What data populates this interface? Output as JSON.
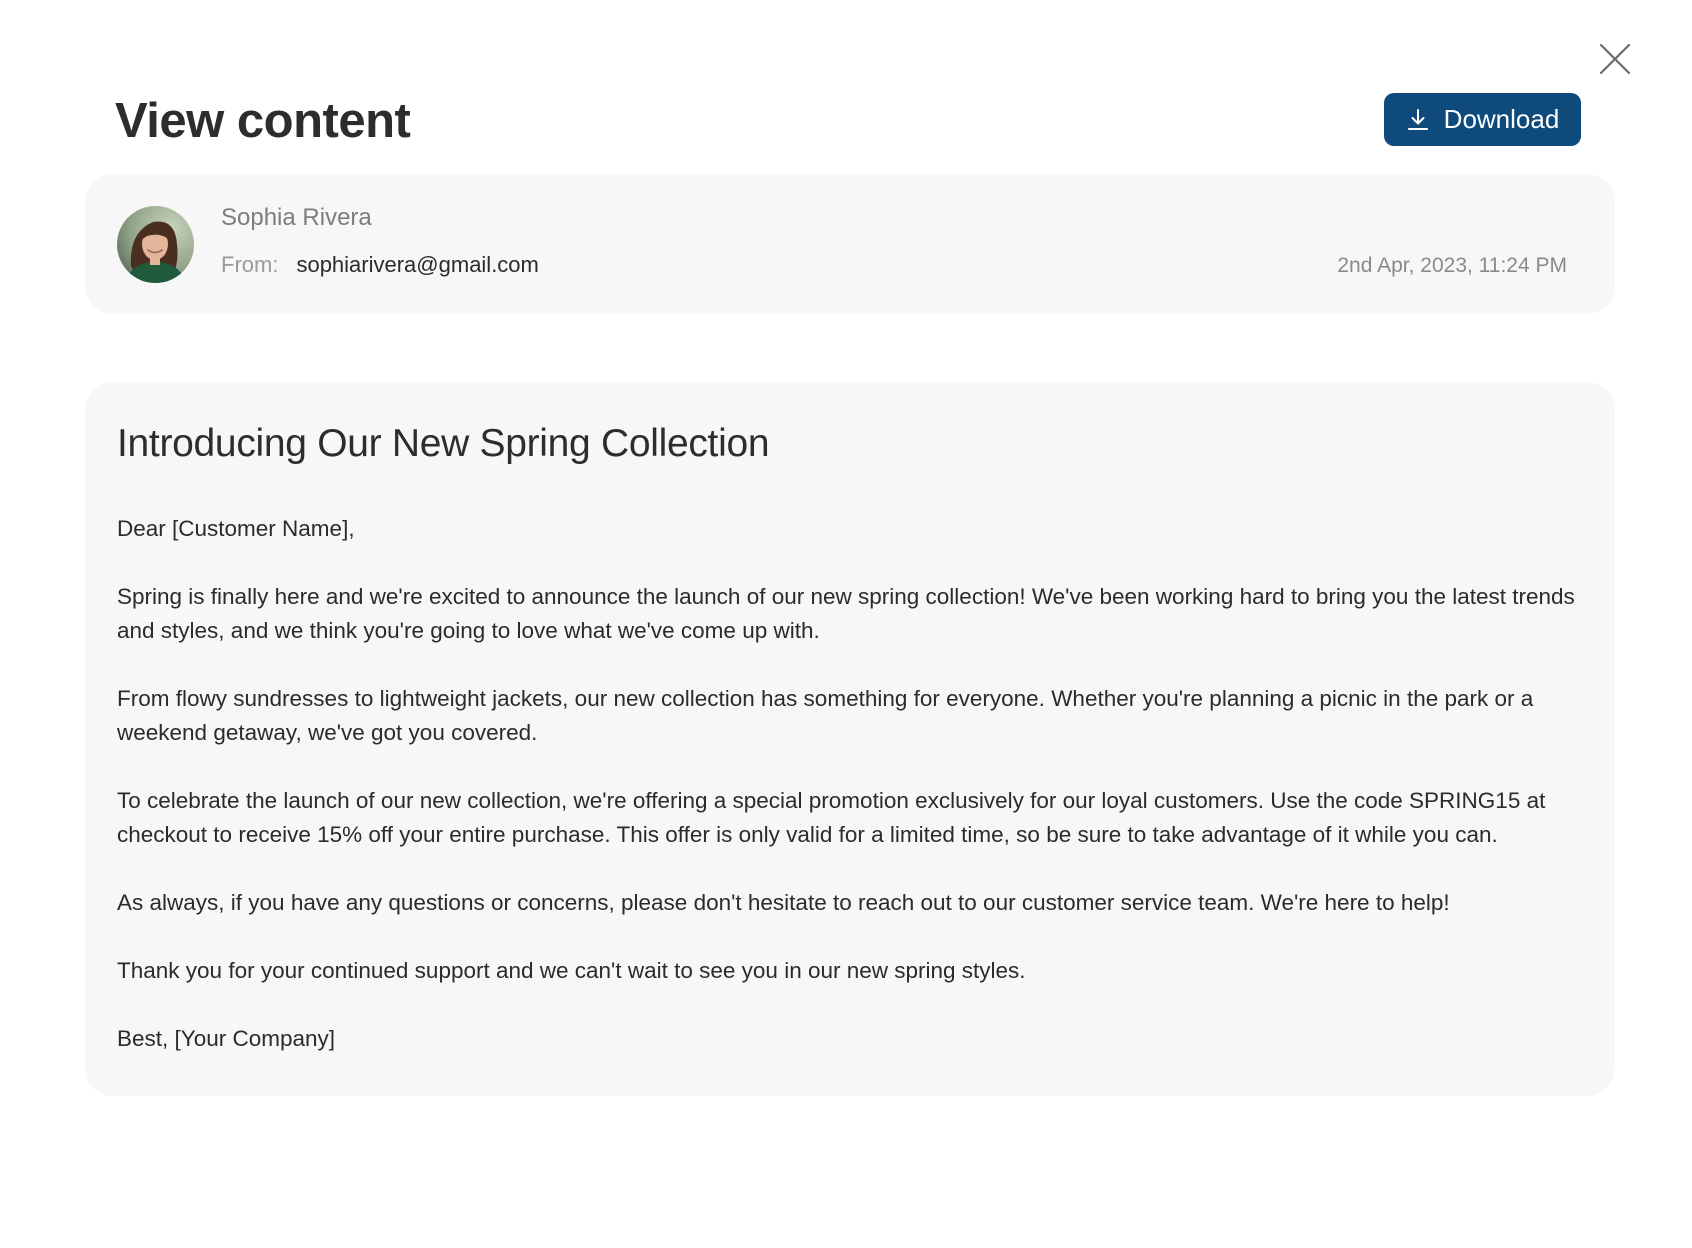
{
  "header": {
    "title": "View content",
    "download_label": "Download"
  },
  "sender": {
    "name": "Sophia Rivera",
    "from_label": "From:",
    "email": "sophiarivera@gmail.com",
    "timestamp": "2nd Apr, 2023, 11:24 PM"
  },
  "message": {
    "subject": "Introducing Our New Spring Collection",
    "paragraphs": [
      "Dear [Customer Name],",
      "Spring is finally here and we're excited to announce the launch of our new spring collection! We've been working hard to bring you the latest trends and styles, and we think you're going to love what we've come up with.",
      "From flowy sundresses to lightweight jackets, our new collection has something for everyone. Whether you're planning a picnic in the park or a weekend getaway, we've got you covered.",
      "To celebrate the launch of our new collection, we're offering a special promotion exclusively for our loyal customers. Use the code SPRING15 at checkout to receive 15% off your entire purchase. This offer is only valid for a limited time, so be sure to take advantage of it while you can.",
      "As always, if you have any questions or concerns, please don't hesitate to reach out to our customer service team. We're here to help!",
      "Thank you for your continued support and we can't wait to see you in our new spring styles.",
      "Best, [Your Company]"
    ]
  },
  "icons": {
    "close": "close-icon",
    "download": "download-icon",
    "avatar": "avatar"
  },
  "colors": {
    "accent": "#0e4a7c",
    "card_background": "#f7f7f7",
    "muted_text": "#8a8a8a"
  }
}
